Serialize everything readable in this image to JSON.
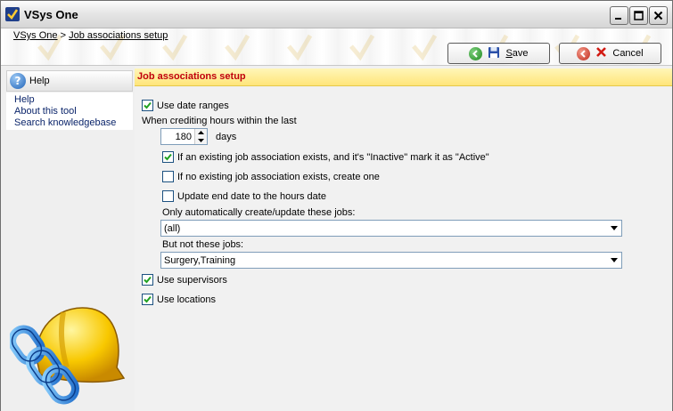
{
  "window": {
    "title": "VSys One",
    "icon": "vsys-check-icon"
  },
  "breadcrumb": {
    "root": "VSys One",
    "separator": ">",
    "current": "Job associations setup"
  },
  "toolbar": {
    "save_label": "Save",
    "save_mnemonic": "S",
    "save_rest": "ave",
    "cancel_label": "Cancel"
  },
  "sidebar": {
    "header": "Help",
    "links": [
      "Help",
      "About this tool",
      "Search knowledgebase"
    ]
  },
  "main": {
    "section_title": "Job associations setup",
    "use_date_ranges": {
      "label": "Use date ranges",
      "checked": true
    },
    "crediting_label": "When crediting hours within the last",
    "days_value": "180",
    "days_unit": "days",
    "mark_active": {
      "label": "If an existing job association exists, and it's \"Inactive\" mark it as \"Active\"",
      "checked": true
    },
    "create_one": {
      "label": "If no existing job association exists, create one",
      "checked": false
    },
    "update_end_date": {
      "label": "Update end date to the hours date",
      "checked": false
    },
    "only_jobs_label": "Only automatically create/update these jobs:",
    "only_jobs_value": "(all)",
    "not_jobs_label": "But not these jobs:",
    "not_jobs_value": "Surgery,Training",
    "use_supervisors": {
      "label": "Use supervisors",
      "checked": true
    },
    "use_locations": {
      "label": "Use locations",
      "checked": true
    }
  },
  "colors": {
    "section_title": "#c0000c",
    "section_band": "#ffe57a",
    "link": "#0a246a"
  }
}
